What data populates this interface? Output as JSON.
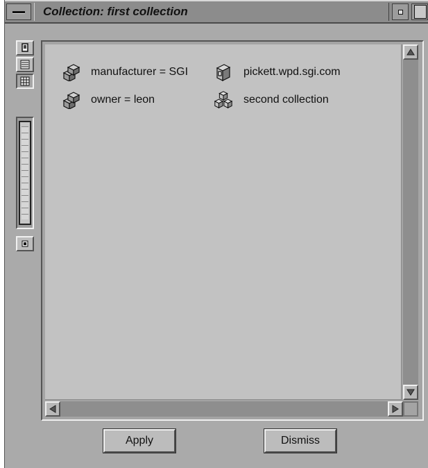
{
  "window": {
    "title": "Collection: first collection"
  },
  "toolbar": {
    "tools": [
      {
        "icon": "view-icon-mode-icon"
      },
      {
        "icon": "list-mode-icon"
      },
      {
        "icon": "grid-mode-icon"
      }
    ],
    "zoom_level": 1.0,
    "bottom_tool_icon": "stop-icon"
  },
  "collection": {
    "items": [
      {
        "label": "manufacturer = SGI",
        "icon": "collection-icon"
      },
      {
        "label": "pickett.wpd.sgi.com",
        "icon": "host-icon"
      },
      {
        "label": "owner = leon",
        "icon": "collection-icon"
      },
      {
        "label": "second collection",
        "icon": "collection-cubes-icon"
      }
    ]
  },
  "buttons": {
    "apply": "Apply",
    "dismiss": "Dismiss"
  },
  "colors": {
    "window_bg": "#aaaaaa",
    "titlebar_bg": "#8c8c8c",
    "view_bg": "#c2c2c2"
  }
}
